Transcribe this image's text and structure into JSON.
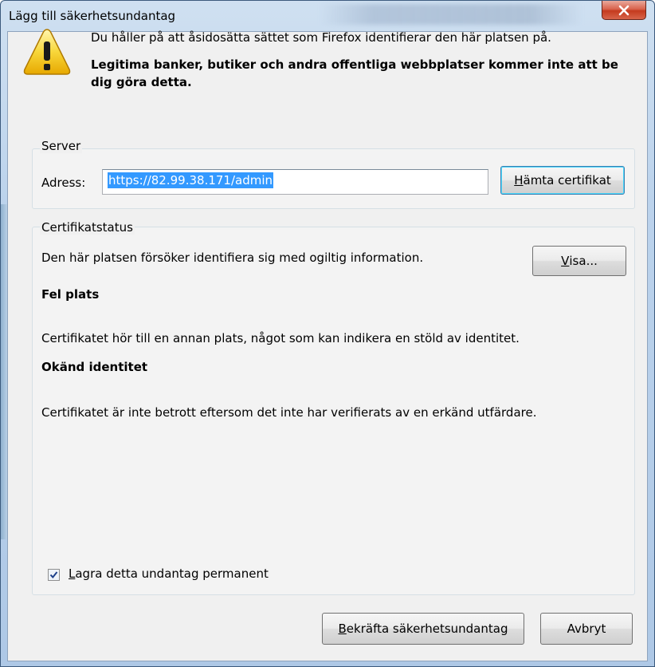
{
  "window": {
    "title": "Lägg till säkerhetsundantag",
    "close_glyph": "x"
  },
  "warning": {
    "icon": "warning-icon",
    "line1": "Du håller på att åsidosätta sättet som Firefox identifierar den här platsen på.",
    "line2": "Legitima banker, butiker och andra offentliga webbplatser kommer inte att be dig göra detta."
  },
  "server": {
    "group_label": "Server",
    "address_label": "Adress:",
    "address_value": "https://82.99.38.171/admin",
    "fetch_button_accel": "H",
    "fetch_button_rest": "ämta certifikat"
  },
  "certificate": {
    "group_label": "Certifikatstatus",
    "status_text": "Den här platsen försöker identifiera sig med ogiltig information.",
    "view_button_accel": "V",
    "view_button_rest": "isa...",
    "problem1_title": "Fel plats",
    "problem1_desc": "Certifikatet hör till en annan plats, något som kan indikera en stöld av identitet.",
    "problem2_title": "Okänd identitet",
    "problem2_desc": "Certifikatet är inte betrott eftersom det inte har verifierats av en erkänd utfärdare."
  },
  "permanent": {
    "checked": true,
    "label_accel": "L",
    "label_rest": "agra detta undantag permanent"
  },
  "buttons": {
    "confirm_accel": "B",
    "confirm_rest": "ekräfta säkerhetsundantag",
    "cancel": "Avbryt"
  }
}
